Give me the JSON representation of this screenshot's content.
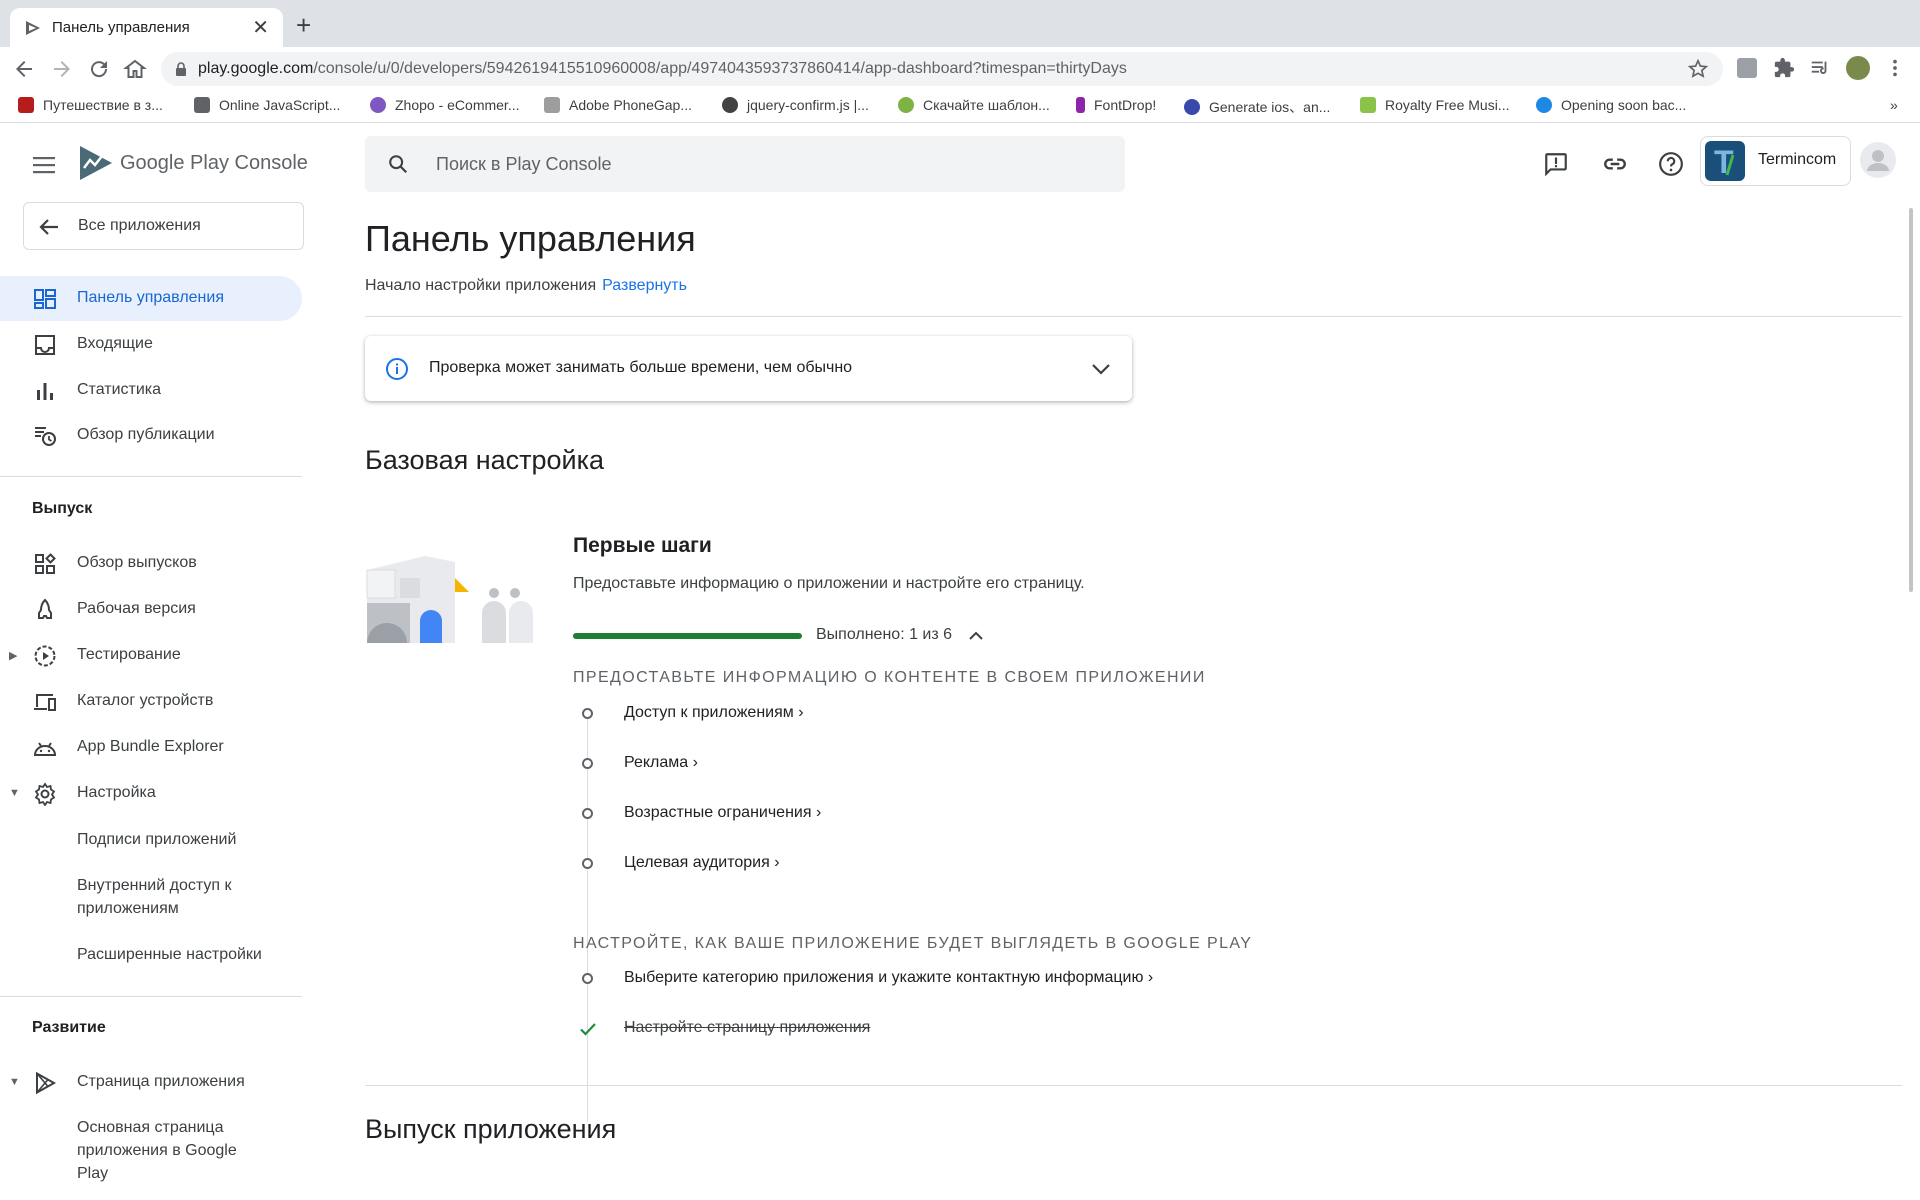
{
  "browser": {
    "tab_title": "Панель управления",
    "close_glyph": "✕",
    "newtab_glyph": "+",
    "url_host": "play.google.com",
    "url_path": "/console/u/0/developers/5942619415510960008/app/4974043593737860414/app-dashboard?timespan=thirtyDays",
    "bookmarks": [
      {
        "label": "Путешествие в з...",
        "color": "#b71c1c"
      },
      {
        "label": "Online JavaScript...",
        "color": "#5f6368"
      },
      {
        "label": "Zhopo - eCommer...",
        "color": "#7e57c2"
      },
      {
        "label": "Adobe PhoneGap...",
        "color": "#9e9e9e"
      },
      {
        "label": "jquery-confirm.js |...",
        "color": "#424242"
      },
      {
        "label": "Скачайте шаблон...",
        "color": "#7cb342"
      },
      {
        "label": "FontDrop!",
        "color": "#8e24aa"
      },
      {
        "label": "Generate ios、an...",
        "color": "#3949ab"
      },
      {
        "label": "Royalty Free Musi...",
        "color": "#8bc34a"
      },
      {
        "label": "Opening soon bac...",
        "color": "#1e88e5"
      }
    ],
    "more_glyph": "»"
  },
  "app": {
    "logo_text": "Google Play Console",
    "search_placeholder": "Поиск в Play Console",
    "account_name": "Termincom",
    "account_initial": "T"
  },
  "sidebar": {
    "all_apps": "Все приложения",
    "top_items": [
      {
        "label": "Панель управления",
        "icon": "dashboard-icon",
        "active": true
      },
      {
        "label": "Входящие",
        "icon": "inbox-icon"
      },
      {
        "label": "Статистика",
        "icon": "bar-chart-icon"
      },
      {
        "label": "Обзор публикации",
        "icon": "publishing-overview-icon"
      }
    ],
    "release_header": "Выпуск",
    "release_items": [
      {
        "label": "Обзор выпусков",
        "icon": "releases-overview-icon"
      },
      {
        "label": "Рабочая версия",
        "icon": "production-icon"
      },
      {
        "label": "Тестирование",
        "icon": "testing-icon",
        "expandable": true
      },
      {
        "label": "Каталог устройств",
        "icon": "devices-icon"
      },
      {
        "label": "App Bundle Explorer",
        "icon": "android-icon"
      },
      {
        "label": "Настройка",
        "icon": "gear-icon",
        "expanded": true
      }
    ],
    "setup_sub_items": [
      "Подписи приложений",
      "Внутренний доступ к приложениям",
      "Расширенные настройки"
    ],
    "grow_header": "Развитие",
    "grow_items": [
      {
        "label": "Страница приложения",
        "icon": "play-store-icon",
        "expanded": true
      }
    ],
    "grow_sub_items": [
      "Основная страница приложения в Google Play"
    ]
  },
  "main": {
    "title": "Панель управления",
    "subtitle": "Начало настройки приложения",
    "expand_link": "Развернуть",
    "alert_text": "Проверка может занимать больше времени, чем обычно",
    "section1_title": "Базовая настройка",
    "card_title": "Первые шаги",
    "card_desc": "Предоставьте информацию о приложении и настройте его страницу.",
    "progress_text": "Выполнено: 1 из 6",
    "progress_fraction": 0.1667,
    "category1": "ПРЕДОСТАВЬТЕ ИНФОРМАЦИЮ О КОНТЕНТЕ В СВОЕМ ПРИЛОЖЕНИИ",
    "cat1_steps": [
      {
        "label": "Доступ к приложениям ›",
        "done": false
      },
      {
        "label": "Реклама ›",
        "done": false
      },
      {
        "label": "Возрастные ограничения ›",
        "done": false
      },
      {
        "label": "Целевая аудитория ›",
        "done": false
      }
    ],
    "category2": "НАСТРОЙТЕ, КАК ВАШЕ ПРИЛОЖЕНИЕ БУДЕТ ВЫГЛЯДЕТЬ В GOOGLE PLAY",
    "cat2_steps": [
      {
        "label": "Выберите категорию приложения и укажите контактную информацию ›",
        "done": false
      },
      {
        "label": "Настройте страницу приложения",
        "done": true
      }
    ],
    "section2_title": "Выпуск приложения"
  }
}
